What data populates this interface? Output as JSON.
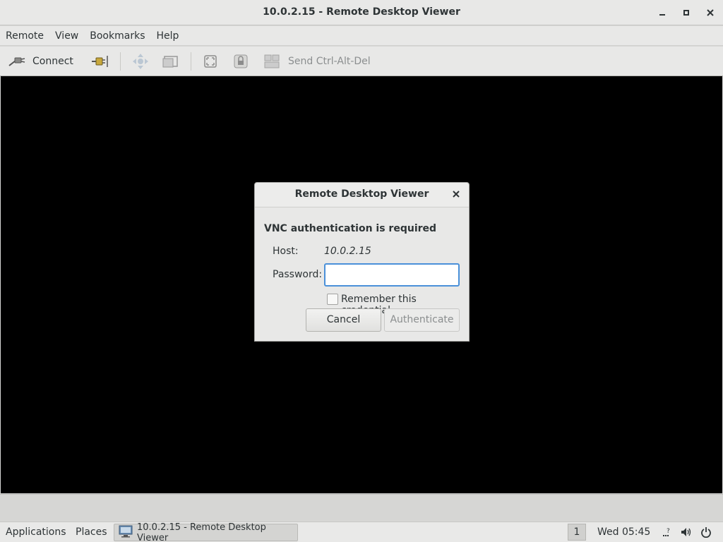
{
  "window": {
    "title": "10.0.2.15 - Remote Desktop Viewer",
    "minimize_icon": "minimize-icon",
    "maximize_icon": "maximize-icon",
    "close_icon": "close-icon"
  },
  "menubar": {
    "items": [
      "Remote",
      "View",
      "Bookmarks",
      "Help"
    ]
  },
  "toolbar": {
    "connect_label": "Connect",
    "send_keys_label": "Send Ctrl-Alt-Del",
    "icons": [
      "connect-icon",
      "disconnect-icon",
      "scroll-icon",
      "screenshot-icon",
      "fullscreen-icon",
      "keyboard-lock-icon",
      "send-keys-icon"
    ]
  },
  "dialog": {
    "title": "Remote Desktop Viewer",
    "heading": "VNC authentication is required",
    "host_label": "Host:",
    "host_value": "10.0.2.15",
    "password_label": "Password:",
    "password_value": "",
    "remember_label": "Remember this credential",
    "remember_checked": false,
    "cancel_label": "Cancel",
    "authenticate_label": "Authenticate"
  },
  "taskbar": {
    "applications_label": "Applications",
    "places_label": "Places",
    "window_label": "10.0.2.15 - Remote Desktop Viewer",
    "workspace": "1",
    "clock": "Wed 05:45",
    "tray_icons": [
      "network-icon",
      "volume-icon",
      "power-icon"
    ]
  },
  "colors": {
    "remote_background": "#000000",
    "focus_border": "#4a90d9",
    "chrome": "#e8e8e7"
  }
}
